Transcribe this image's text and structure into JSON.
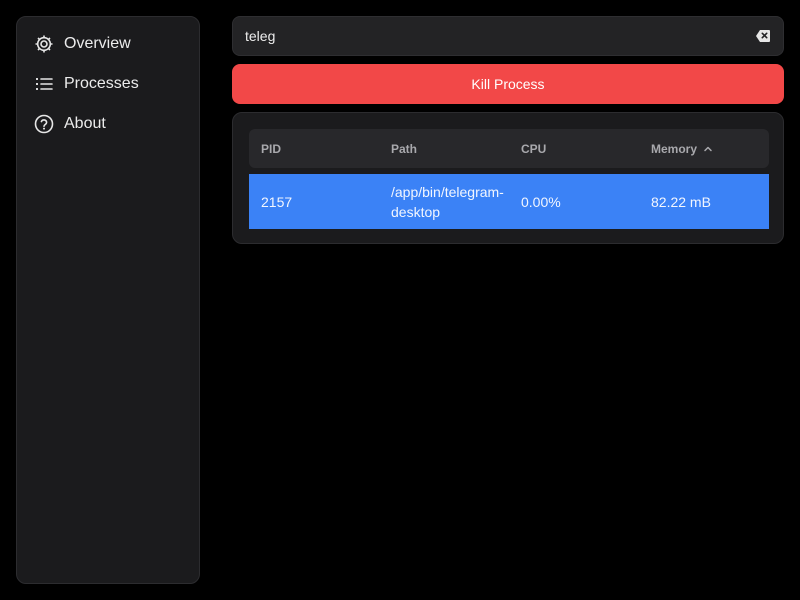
{
  "sidebar": {
    "items": [
      {
        "label": "Overview",
        "icon": "gear-icon"
      },
      {
        "label": "Processes",
        "icon": "list-icon"
      },
      {
        "label": "About",
        "icon": "help-circle-icon"
      }
    ]
  },
  "search": {
    "value": "teleg"
  },
  "actions": {
    "kill_label": "Kill Process",
    "kill_color": "#f24848"
  },
  "table": {
    "columns": [
      "PID",
      "Path",
      "CPU",
      "Memory"
    ],
    "sorted_column": "Memory",
    "sort_direction": "ascending",
    "rows": [
      {
        "pid": "2157",
        "path": "/app/bin/telegram-desktop",
        "cpu": "0.00%",
        "memory": "82.22 mB",
        "selected": true
      }
    ],
    "selection_color": "#3b82f6"
  }
}
